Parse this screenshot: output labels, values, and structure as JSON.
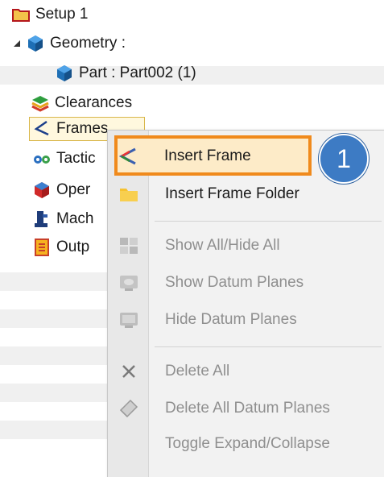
{
  "tree": {
    "setup": "Setup 1",
    "geometry": "Geometry :",
    "part": "Part : Part002 (1)",
    "clearances": "Clearances",
    "frames": "Frames",
    "tactics": "Tactic",
    "operations": "Oper",
    "machine": "Mach",
    "output": "Outp"
  },
  "menu": {
    "insert_frame": "Insert Frame",
    "insert_frame_folder": "Insert Frame Folder",
    "show_all_hide_all": "Show All/Hide All",
    "show_datum_planes": "Show Datum Planes",
    "hide_datum_planes": "Hide Datum Planes",
    "delete_all": "Delete All",
    "delete_all_datum_planes": "Delete All Datum Planes",
    "toggle_expand_collapse": "Toggle Expand/Collapse"
  },
  "callout_number": "1",
  "colors": {
    "highlight_border": "#f08a1c",
    "callout_fill": "#3d7bc4",
    "disabled_text": "#8f8f8f"
  },
  "icons": {
    "setup": "setup-folder-icon",
    "geometry": "geometry-cube-icon",
    "part": "part-cube-icon",
    "clearances": "clearances-layers-icon",
    "frames": "frame-axis-icon",
    "tactics": "tactics-gears-icon",
    "operations": "operations-cube-icon",
    "machine": "machine-icon",
    "output": "output-document-icon"
  }
}
